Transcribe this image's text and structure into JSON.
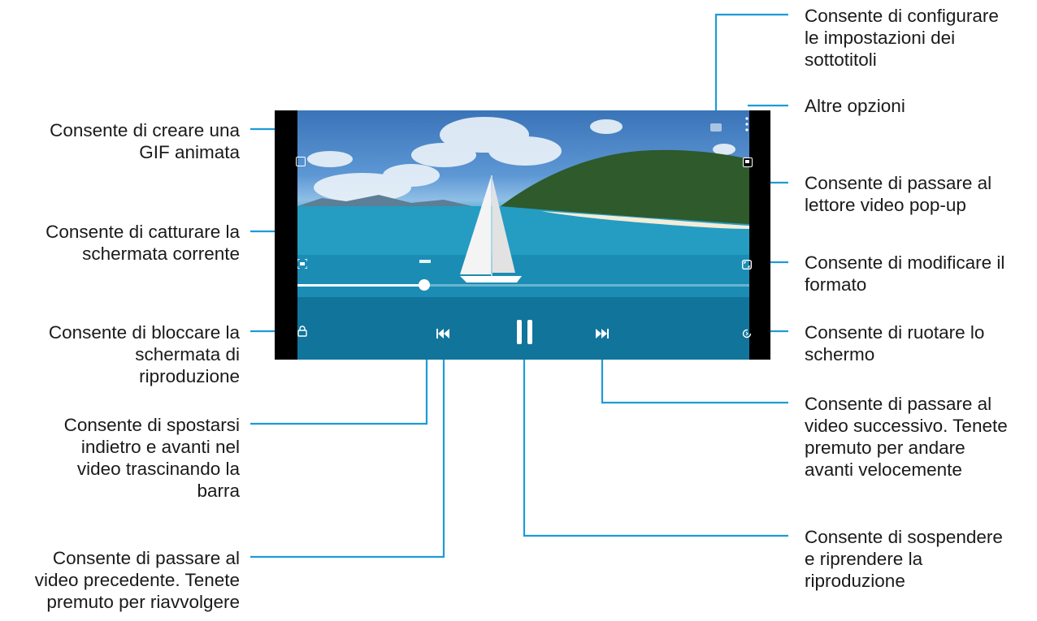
{
  "callouts": {
    "subtitle_settings": [
      "Consente di configurare",
      "le impostazioni dei",
      "sottotitoli"
    ],
    "more_options": [
      "Altre opzioni"
    ],
    "popup_player": [
      "Consente di passare al",
      "lettore video pop-up"
    ],
    "aspect_ratio": [
      "Consente di modificare il",
      "formato"
    ],
    "rotate_screen": [
      "Consente di ruotare lo",
      "schermo"
    ],
    "next_video": [
      "Consente di passare al",
      "video successivo. Tenete",
      "premuto per andare",
      "avanti velocemente"
    ],
    "pause_resume": [
      "Consente di sospendere",
      "e riprendere la",
      "riproduzione"
    ],
    "create_gif": [
      "Consente di creare una",
      "GIF animata"
    ],
    "capture_screen": [
      "Consente di catturare la",
      "schermata corrente"
    ],
    "lock_screen": [
      "Consente di bloccare la",
      "schermata di",
      "riproduzione"
    ],
    "seek_bar": [
      "Consente di spostarsi",
      "indietro e avanti nel",
      "video trascinando la",
      "barra"
    ],
    "previous_video": [
      "Consente di passare al",
      "video precedente. Tenete",
      "premuto per riavvolgere"
    ]
  },
  "player": {
    "progress": 0.28
  },
  "icons": {
    "gif": "gif-icon",
    "capture": "capture-icon",
    "lock": "lock-icon",
    "subtitle": "subtitle-icon",
    "more": "more-options-icon",
    "popup": "popup-player-icon",
    "aspect": "aspect-ratio-icon",
    "rotate": "rotate-icon",
    "previous": "previous-icon",
    "pause": "pause-icon",
    "next": "next-icon"
  },
  "colors": {
    "leader_line": "#1d9bd6",
    "frame": "#000000"
  }
}
